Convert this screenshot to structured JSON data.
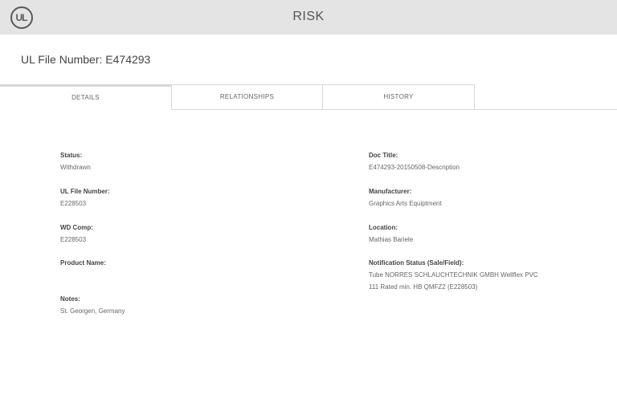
{
  "header": {
    "logo_text": "UL",
    "title": "RISK"
  },
  "page_title": "UL File Number: E474293",
  "tabs": [
    {
      "label": "DETAILS",
      "active": true
    },
    {
      "label": "RELATIONSHIPS",
      "active": false
    },
    {
      "label": "HISTORY",
      "active": false
    }
  ],
  "details": {
    "left": [
      {
        "label": "Status:",
        "value": "Withdrawn"
      },
      {
        "label": "UL File Number:",
        "value": "E228503"
      },
      {
        "label": "WD Comp:",
        "value": "E228503"
      },
      {
        "label": "Product Name:",
        "value": ""
      },
      {
        "label": "Notes:",
        "value": "St. Georgen, Germany"
      }
    ],
    "right": [
      {
        "label": "Doc Title:",
        "value": "E474293-20150508-Description"
      },
      {
        "label": "Manufacturer:",
        "value": "Graphics Arts Equiptment"
      },
      {
        "label": "Location:",
        "value": "Mathias Bariele"
      },
      {
        "label": "Notification Status (Sale/Field):",
        "value_line1": "Tube NORRES SCHLAUCHTECHNIK GMBH Wellflex PVC",
        "value_line2": "111 Rated min. HB QMFZ2 (E228503)"
      }
    ]
  }
}
